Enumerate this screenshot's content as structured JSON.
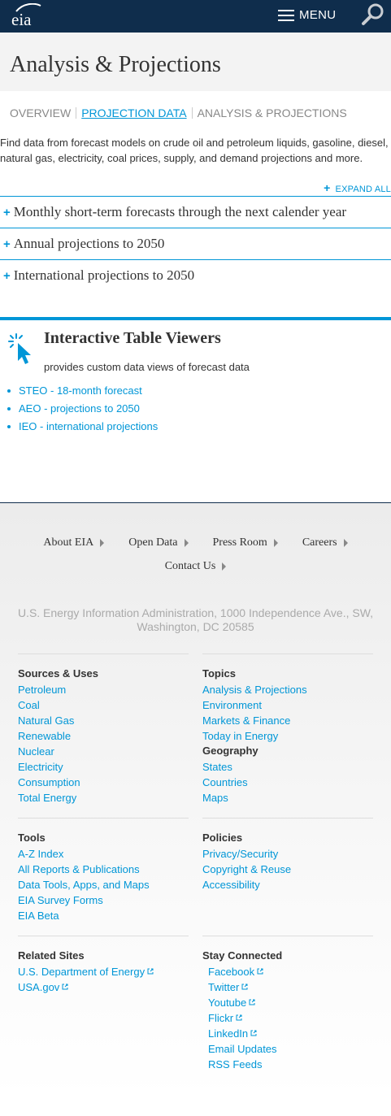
{
  "header": {
    "logo_text": "eia",
    "menu_label": "MENU"
  },
  "page_title": "Analysis & Projections",
  "subnav": [
    {
      "label": "OVERVIEW",
      "active": false
    },
    {
      "label": "PROJECTION DATA",
      "active": true
    },
    {
      "label": "ANALYSIS & PROJECTIONS",
      "active": false
    }
  ],
  "intro": "Find data from forecast models on crude oil and petroleum liquids, gasoline, diesel, natural gas, electricity, coal prices, supply, and demand projections and more.",
  "expand_all": "EXPAND ALL",
  "accordion": [
    "Monthly short-term forecasts through the next calender year",
    "Annual projections to 2050",
    "International projections to 2050"
  ],
  "viewers": {
    "title": "Interactive Table Viewers",
    "description": "provides custom data views of forecast data",
    "links": [
      "STEO - 18-month forecast",
      "AEO - projections to 2050",
      "IEO - international projections"
    ]
  },
  "footer": {
    "nav": [
      "About EIA",
      "Open Data",
      "Press Room",
      "Careers",
      "Contact Us"
    ],
    "address": "U.S. Energy Information Administration, 1000 Independence Ave., SW, Washington, DC 20585",
    "sources": {
      "heading": "Sources & Uses",
      "links": [
        "Petroleum",
        "Coal",
        "Natural Gas",
        "Renewable",
        "Nuclear",
        "Electricity",
        "Consumption",
        "Total Energy"
      ]
    },
    "topics": {
      "heading": "Topics",
      "links": [
        "Analysis & Projections",
        "Environment",
        "Markets & Finance",
        "Today in Energy"
      ]
    },
    "geography": {
      "heading": "Geography",
      "links": [
        "States",
        "Countries",
        "Maps"
      ]
    },
    "tools": {
      "heading": "Tools",
      "links": [
        "A-Z Index",
        "All Reports & Publications",
        "Data Tools, Apps, and Maps",
        "EIA Survey Forms",
        "EIA Beta"
      ]
    },
    "policies": {
      "heading": "Policies",
      "links": [
        "Privacy/Security",
        "Copyright & Reuse",
        "Accessibility"
      ]
    },
    "related": {
      "heading": "Related Sites",
      "links": [
        "U.S. Department of Energy",
        "USA.gov"
      ]
    },
    "stay_connected": {
      "heading": "Stay Connected",
      "links": [
        "Facebook",
        "Twitter",
        "Youtube",
        "Flickr",
        "LinkedIn",
        "Email Updates",
        "RSS Feeds"
      ]
    }
  },
  "colors": {
    "nav_bg": "#0f2d4c",
    "accent": "#0096d7"
  }
}
